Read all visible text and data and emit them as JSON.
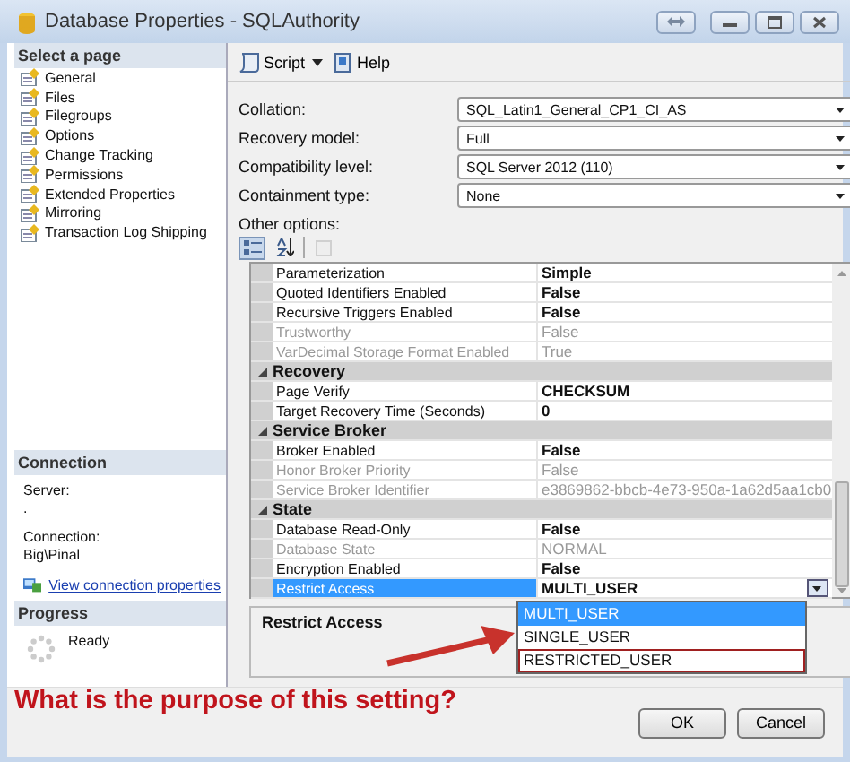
{
  "window": {
    "title": "Database Properties - SQLAuthority"
  },
  "sidebar": {
    "heading": "Select a page",
    "items": [
      {
        "label": "General"
      },
      {
        "label": "Files"
      },
      {
        "label": "Filegroups"
      },
      {
        "label": "Options"
      },
      {
        "label": "Change Tracking"
      },
      {
        "label": "Permissions"
      },
      {
        "label": "Extended Properties"
      },
      {
        "label": "Mirroring"
      },
      {
        "label": "Transaction Log Shipping"
      }
    ]
  },
  "connection": {
    "heading": "Connection",
    "server_label": "Server:",
    "server": ".",
    "connection_label": "Connection:",
    "connection": "Big\\Pinal",
    "link": "View connection properties"
  },
  "progress": {
    "heading": "Progress",
    "status": "Ready"
  },
  "toolbar": [
    {
      "kind": "script",
      "label": "Script"
    },
    {
      "kind": "help",
      "label": "Help"
    }
  ],
  "form": [
    {
      "label": "Collation:",
      "value": "SQL_Latin1_General_CP1_CI_AS"
    },
    {
      "label": "Recovery model:",
      "value": "Full"
    },
    {
      "label": "Compatibility level:",
      "value": "SQL Server 2012 (110)"
    },
    {
      "label": "Containment type:",
      "value": "None"
    }
  ],
  "other_options_label": "Other options:",
  "sort_buttons": [
    {
      "kind": "categorized",
      "selected": true
    },
    {
      "kind": "alphabetical",
      "selected": false
    }
  ],
  "property_grid": {
    "sections": [
      {
        "rows": [
          {
            "name": "Parameterization",
            "value": "Simple",
            "disabled": false,
            "selected": false
          },
          {
            "name": "Quoted Identifiers Enabled",
            "value": "False",
            "disabled": false,
            "selected": false
          },
          {
            "name": "Recursive Triggers Enabled",
            "value": "False",
            "disabled": false,
            "selected": false
          },
          {
            "name": "Trustworthy",
            "value": "False",
            "disabled": true,
            "selected": false
          },
          {
            "name": "VarDecimal Storage Format Enabled",
            "value": "True",
            "disabled": true,
            "selected": false
          }
        ]
      },
      {
        "category": "Recovery",
        "expanded": true,
        "rows": [
          {
            "name": "Page Verify",
            "value": "CHECKSUM",
            "disabled": false,
            "selected": false
          },
          {
            "name": "Target Recovery Time (Seconds)",
            "value": "0",
            "disabled": false,
            "selected": false
          }
        ]
      },
      {
        "category": "Service Broker",
        "expanded": true,
        "rows": [
          {
            "name": "Broker Enabled",
            "value": "False",
            "disabled": false,
            "selected": false
          },
          {
            "name": "Honor Broker Priority",
            "value": "False",
            "disabled": true,
            "selected": false
          },
          {
            "name": "Service Broker Identifier",
            "value": "e3869862-bbcb-4e73-950a-1a62d5aa1cb0",
            "disabled": true,
            "selected": false
          }
        ]
      },
      {
        "category": "State",
        "expanded": true,
        "rows": [
          {
            "name": "Database Read-Only",
            "value": "False",
            "disabled": false,
            "selected": false
          },
          {
            "name": "Database State",
            "value": "NORMAL",
            "disabled": true,
            "selected": false
          },
          {
            "name": "Encryption Enabled",
            "value": "False",
            "disabled": false,
            "selected": false
          },
          {
            "name": "Restrict Access",
            "value": "MULTI_USER",
            "disabled": false,
            "selected": true
          }
        ]
      }
    ]
  },
  "dropdown": {
    "items": [
      {
        "label": "MULTI_USER",
        "selected": true,
        "marked": false
      },
      {
        "label": "SINGLE_USER",
        "selected": false,
        "marked": false
      },
      {
        "label": "RESTRICTED_USER",
        "selected": false,
        "marked": true
      }
    ]
  },
  "description": {
    "title": "Restrict Access"
  },
  "annotation": "What is the purpose of this setting?",
  "buttons": [
    {
      "label": "OK"
    },
    {
      "label": "Cancel"
    }
  ]
}
